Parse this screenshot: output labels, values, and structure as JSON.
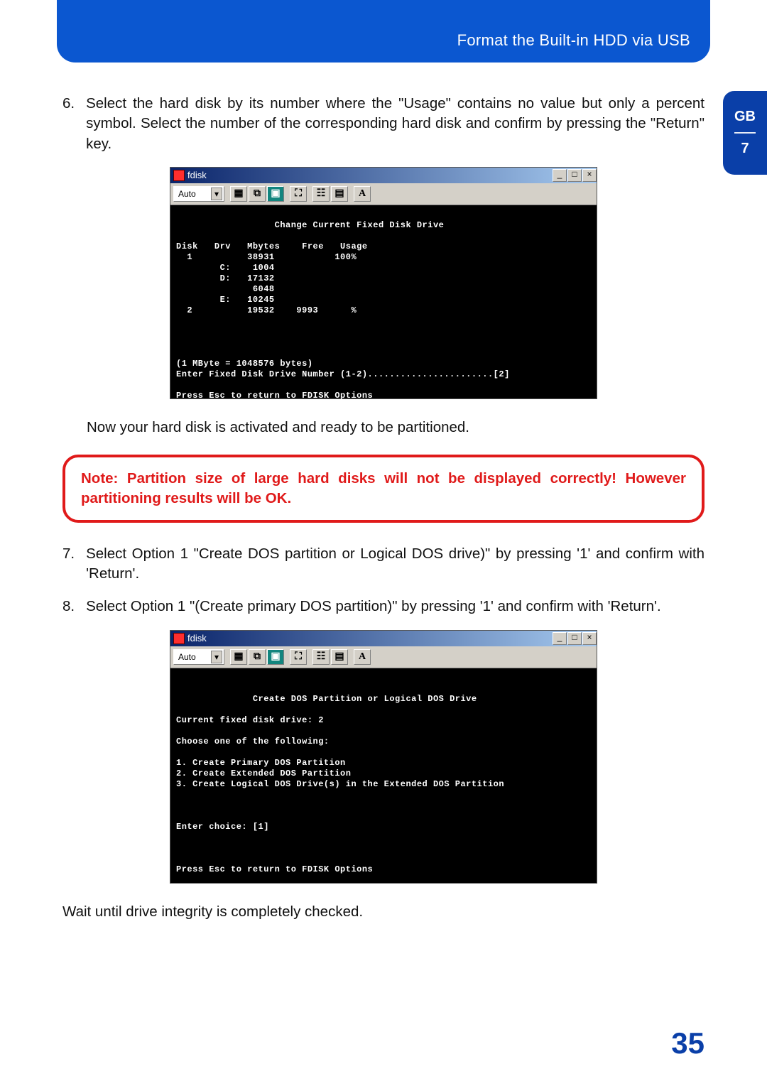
{
  "header": {
    "title": "Format the Built-in HDD via USB"
  },
  "tab": {
    "lang": "GB",
    "page": "7"
  },
  "steps": {
    "s6": {
      "num": "6.",
      "text": "Select the hard disk by its number where the \"Usage\" contains no value but only a percent symbol. Select the number of the corresponding hard disk and confirm by pressing the \"Return\" key."
    },
    "after6": "Now your hard disk is activated and ready to be partitioned.",
    "note": "Note: Partition size of large hard disks will not be displayed correctly! However partitioning results will be OK.",
    "s7": {
      "num": "7.",
      "text": "Select Option 1 \"Create DOS partition or Logical DOS drive)\" by pressing '1' and confirm with 'Return'."
    },
    "s8": {
      "num": "8.",
      "text": "Select Option 1 \"(Create primary DOS partition)\" by pressing '1' and confirm with 'Return'."
    },
    "after8": "Wait until drive integrity is completely checked."
  },
  "fdisk_common": {
    "title": "fdisk",
    "toolbar_mode": "Auto",
    "toolbar_A": "A",
    "btn_min": "_",
    "btn_max": "□",
    "btn_close": "×"
  },
  "fdisk1": {
    "heading": "Change Current Fixed Disk Drive",
    "cols": "Disk   Drv   Mbytes    Free   Usage",
    "rows": [
      "  1          38931           100%",
      "        C:    1004",
      "        D:   17132",
      "              6048",
      "        E:   10245",
      "  2          19532    9993      %"
    ],
    "footer1": "(1 MByte = 1048576 bytes)",
    "footer2": "Enter Fixed Disk Drive Number (1-2).......................[2]",
    "footer3": "Press Esc to return to FDISK Options"
  },
  "fdisk2": {
    "heading": "Create DOS Partition or Logical DOS Drive",
    "line_current": "Current fixed disk drive: 2",
    "line_choose": "Choose one of the following:",
    "opts": [
      "1. Create Primary DOS Partition",
      "2. Create Extended DOS Partition",
      "3. Create Logical DOS Drive(s) in the Extended DOS Partition"
    ],
    "enter": "Enter choice: [1]",
    "footer": "Press Esc to return to FDISK Options"
  },
  "page_number": "35"
}
